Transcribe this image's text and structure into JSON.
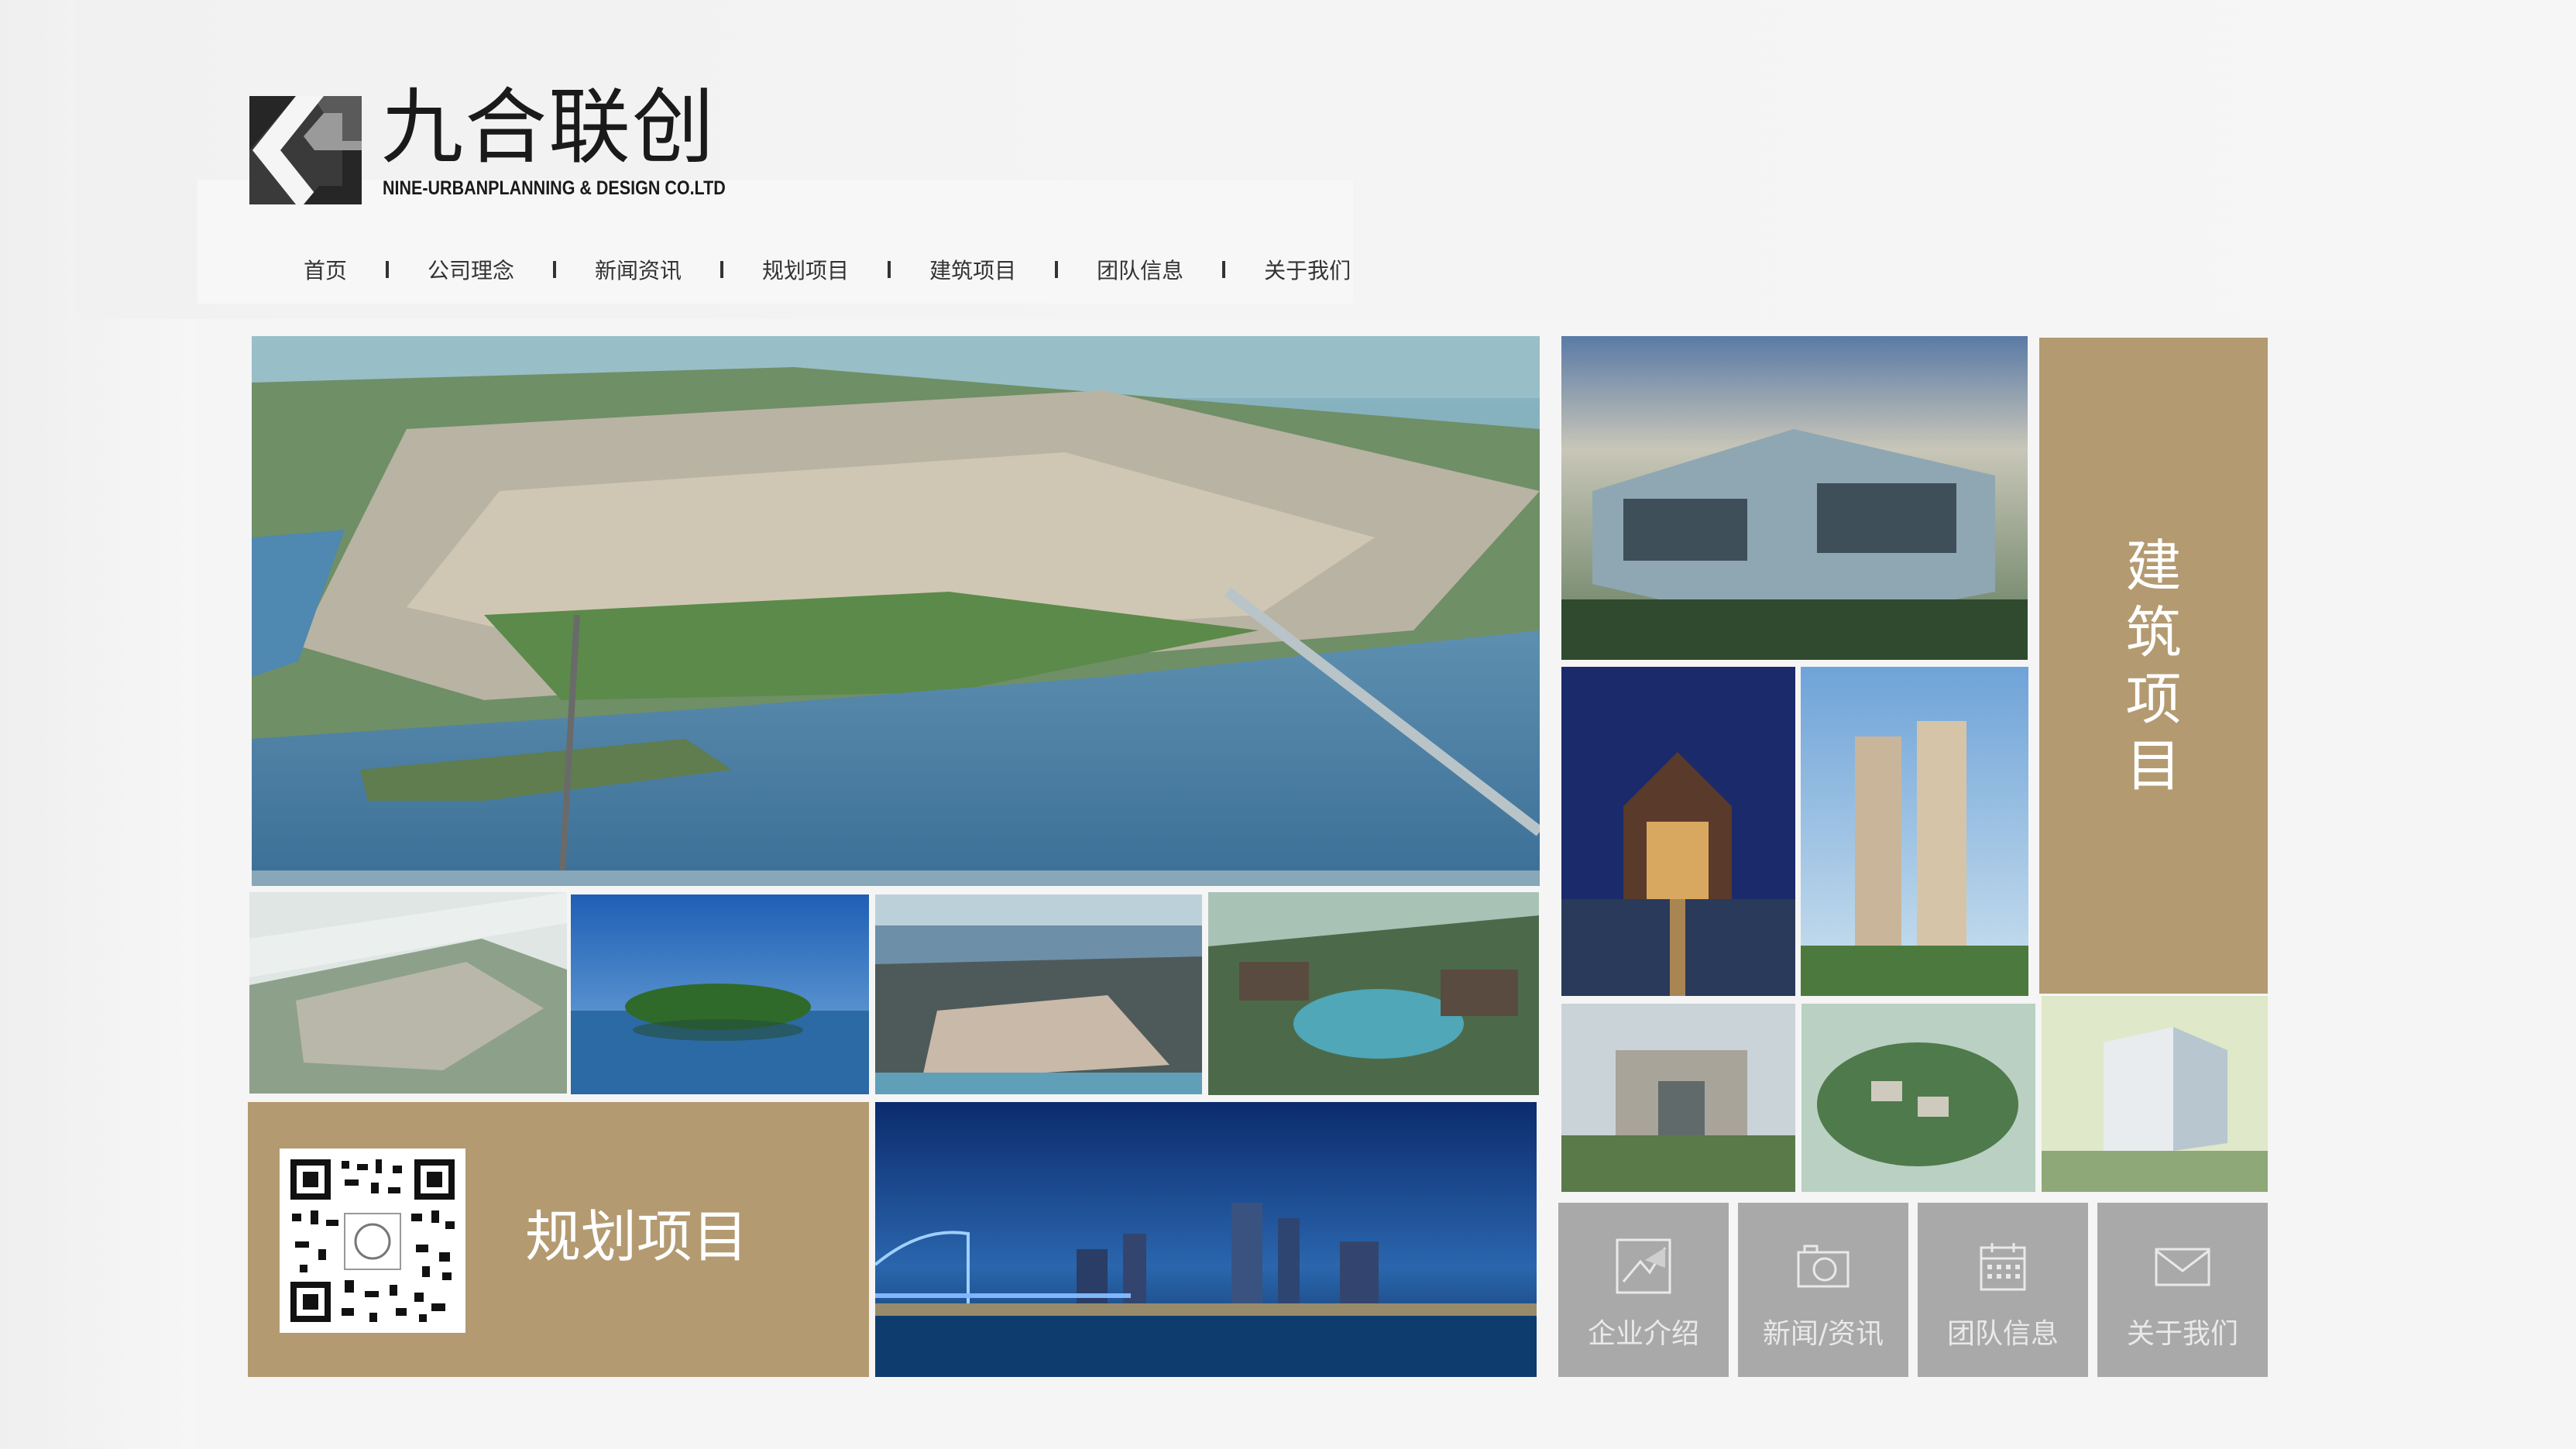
{
  "brand": {
    "name_cn": "九合联创",
    "name_en": "NINE-URBANPLANNING & DESIGN CO.LTD"
  },
  "nav": {
    "items": [
      "首页",
      "公司理念",
      "新闻资讯",
      "规划项目",
      "建筑项目",
      "团队信息",
      "关于我们"
    ]
  },
  "tiles": {
    "architecture_label": [
      "建",
      "筑",
      "项",
      "目"
    ],
    "planning_label": "规划项目"
  },
  "quick_links": [
    {
      "label": "企业介绍",
      "icon": "logo-outline-icon"
    },
    {
      "label": "新闻/资讯",
      "icon": "camera-icon"
    },
    {
      "label": "团队信息",
      "icon": "calendar-icon"
    },
    {
      "label": "关于我们",
      "icon": "envelope-icon"
    }
  ],
  "colors": {
    "accent_gold": "#b39a71",
    "button_gray": "#a9a9a9",
    "text_dark": "#1a1a1a"
  }
}
